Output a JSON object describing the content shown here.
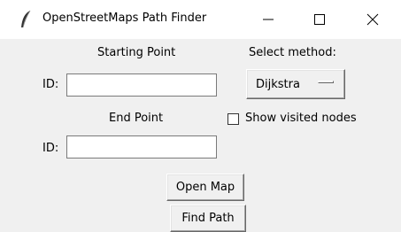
{
  "window": {
    "title": "OpenStreetMaps Path Finder",
    "app_icon": "feather-icon",
    "controls": [
      "minimize-icon",
      "maximize-icon",
      "close-icon"
    ]
  },
  "form": {
    "start": {
      "heading": "Starting Point",
      "id_label": "ID:",
      "value": ""
    },
    "end": {
      "heading": "End Point",
      "id_label": "ID:",
      "value": ""
    },
    "method": {
      "heading": "Select method:",
      "selected": "Dijkstra"
    },
    "show_visited": {
      "label": "Show visited nodes",
      "checked": false
    },
    "open_map_label": "Open Map",
    "find_path_label": "Find Path"
  }
}
